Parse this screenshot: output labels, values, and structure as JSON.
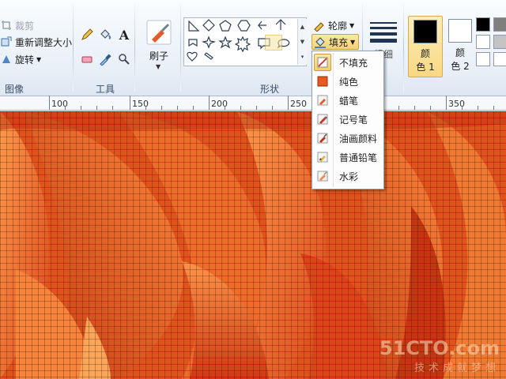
{
  "ribbon": {
    "image_group": {
      "label": "图像",
      "crop_label": "裁剪",
      "resize_label": "重新调整大小",
      "rotate_label": "旋转"
    },
    "tools_group": {
      "label": "工具"
    },
    "brushes": {
      "label": "刷子"
    },
    "shapes_group": {
      "label": "形状",
      "outline_label": "轮廓",
      "fill_label": "填充"
    },
    "size": {
      "label": "粗细"
    },
    "colors": {
      "color1_label": "颜色 1",
      "color1_line1": "颜",
      "color1_line2": "色 1",
      "color2_line1": "颜",
      "color2_line2": "色 2",
      "color1_value": "#000000",
      "color2_value": "#ffffff",
      "palette": [
        "#000000",
        "#7f7f7f",
        "#ffffff",
        "#c3c3c3",
        "#ffffff",
        "#ffffff"
      ]
    }
  },
  "ruler": {
    "labels": [
      "100",
      "150",
      "200",
      "250",
      "350"
    ]
  },
  "fill_menu": {
    "items": [
      {
        "label": "不填充",
        "icon": "no-fill-icon",
        "selected": true
      },
      {
        "label": "纯色",
        "icon": "solid-color-icon",
        "selected": false
      },
      {
        "label": "蜡笔",
        "icon": "crayon-icon",
        "selected": false
      },
      {
        "label": "记号笔",
        "icon": "marker-icon",
        "selected": false
      },
      {
        "label": "油画颜料",
        "icon": "oil-paint-icon",
        "selected": false
      },
      {
        "label": "普通铅笔",
        "icon": "pencil-icon",
        "selected": false
      },
      {
        "label": "水彩",
        "icon": "watercolor-icon",
        "selected": false
      }
    ]
  },
  "watermark": {
    "main": "51CTO.com",
    "sub": "技术成就梦想"
  },
  "colors": {
    "accent_selected": "#f7d271",
    "canvas_orange": "#ea5a1e"
  }
}
